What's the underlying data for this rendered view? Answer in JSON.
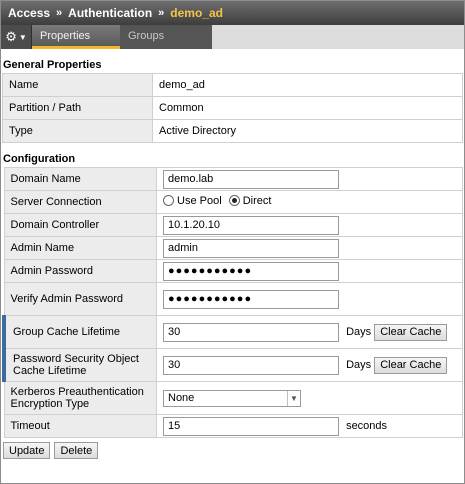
{
  "breadcrumb": {
    "part1": "Access",
    "part2": "Authentication",
    "current": "demo_ad",
    "sep": "»"
  },
  "tabs": {
    "gear": "⚙",
    "active": "Properties",
    "inactive": "Groups"
  },
  "general": {
    "title": "General Properties",
    "rows": [
      {
        "label": "Name",
        "value": "demo_ad"
      },
      {
        "label": "Partition / Path",
        "value": "Common"
      },
      {
        "label": "Type",
        "value": "Active Directory"
      }
    ]
  },
  "config": {
    "title": "Configuration",
    "domain_name": {
      "label": "Domain Name",
      "value": "demo.lab"
    },
    "server_connection": {
      "label": "Server Connection",
      "opt1": "Use Pool",
      "opt2": "Direct",
      "selected": "Direct"
    },
    "domain_controller": {
      "label": "Domain Controller",
      "value": "10.1.20.10"
    },
    "admin_name": {
      "label": "Admin Name",
      "value": "admin"
    },
    "admin_password": {
      "label": "Admin Password",
      "value": "●●●●●●●●●●●"
    },
    "verify_password": {
      "label": "Verify Admin Password",
      "value": "●●●●●●●●●●●"
    },
    "group_cache": {
      "label": "Group Cache Lifetime",
      "value": "30",
      "unit": "Days",
      "button": "Clear Cache"
    },
    "pso_cache": {
      "label": "Password Security Object Cache Lifetime",
      "value": "30",
      "unit": "Days",
      "button": "Clear Cache"
    },
    "kerberos": {
      "label": "Kerberos Preauthentication Encryption Type",
      "value": "None"
    },
    "timeout": {
      "label": "Timeout",
      "value": "15",
      "unit": "seconds"
    }
  },
  "actions": {
    "update": "Update",
    "delete": "Delete"
  }
}
